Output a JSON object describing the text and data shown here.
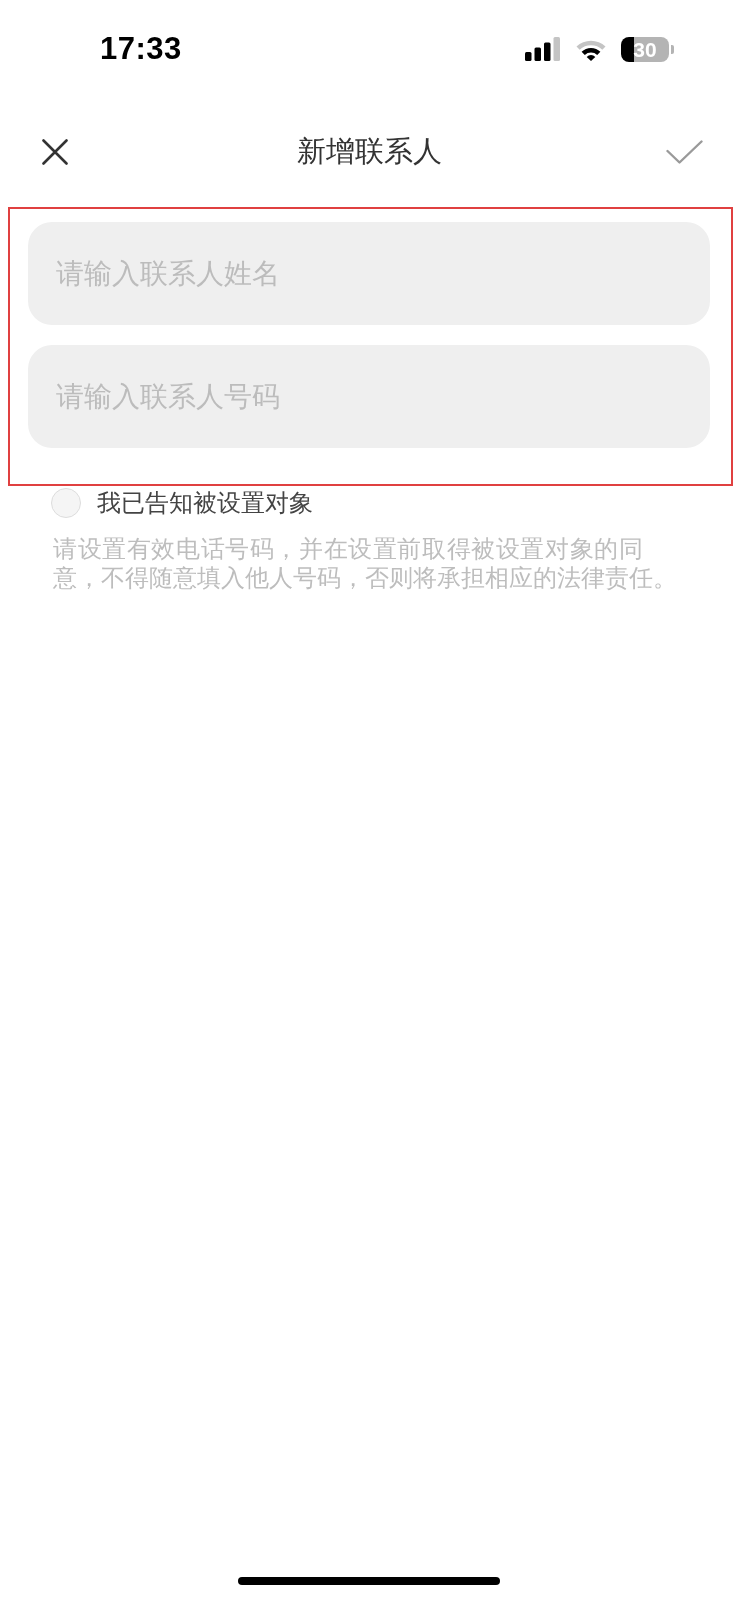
{
  "status_bar": {
    "time": "17:33",
    "battery": "30"
  },
  "header": {
    "title": "新增联系人",
    "confirm_disabled": true
  },
  "fields": [
    {
      "placeholder": "请输入联系人姓名"
    },
    {
      "placeholder": "请输入联系人号码"
    }
  ],
  "consent": {
    "label": "我已告知被设置对象",
    "checked": false
  },
  "notice": "请设置有效电话号码，并在设置前取得被设置对象的同意，不得随意填入他人号码，否则将承担相应的法律责任。"
}
